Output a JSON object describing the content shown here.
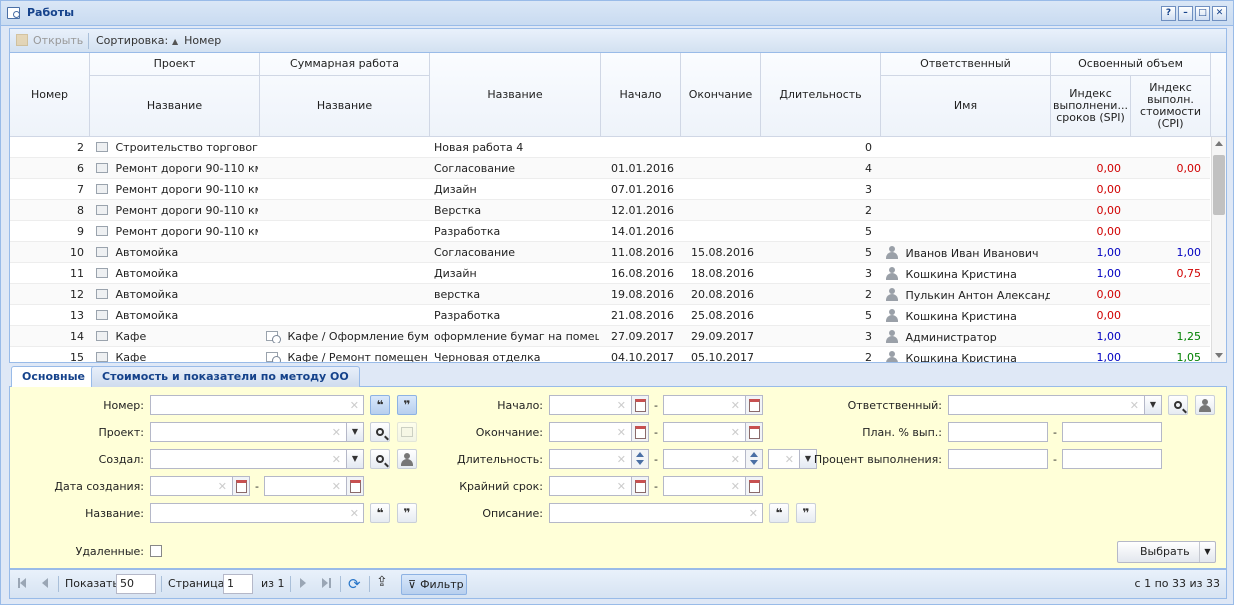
{
  "window": {
    "title": "Работы",
    "tools": [
      "?",
      "–",
      "□",
      "✕"
    ]
  },
  "toolbar": {
    "open_label": "Открыть",
    "sort_label": "Сортировка:",
    "sort_field": "Номер"
  },
  "columns": {
    "number": "Номер",
    "project_group": "Проект",
    "project_name": "Название",
    "summary_group": "Суммарная работа",
    "summary_name": "Название",
    "name": "Название",
    "start": "Начало",
    "end": "Окончание",
    "duration": "Длительность",
    "responsible_group": "Ответственный",
    "responsible_name": "Имя",
    "earned_group": "Освоенный объем",
    "spi": "Индекс выполнени... сроков (SPI)",
    "cpi": "Индекс выполн. стоимости (CPI)"
  },
  "rows": [
    {
      "num": "2",
      "project": "Строительство торговог...",
      "summary": "",
      "name": "Новая работа 4",
      "start": "",
      "end": "",
      "duration": "0",
      "responsible": "",
      "spi": "",
      "spi_color": "",
      "cpi": "",
      "cpi_color": ""
    },
    {
      "num": "6",
      "project": "Ремонт дороги 90-110 км",
      "summary": "",
      "name": "Согласование",
      "start": "01.01.2016",
      "end": "",
      "duration": "4",
      "responsible": "",
      "spi": "0,00",
      "spi_color": "#d00000",
      "cpi": "0,00",
      "cpi_color": "#d00000"
    },
    {
      "num": "7",
      "project": "Ремонт дороги 90-110 км",
      "summary": "",
      "name": "Дизайн",
      "start": "07.01.2016",
      "end": "",
      "duration": "3",
      "responsible": "",
      "spi": "0,00",
      "spi_color": "#d00000",
      "cpi": "",
      "cpi_color": ""
    },
    {
      "num": "8",
      "project": "Ремонт дороги 90-110 км",
      "summary": "",
      "name": "Верстка",
      "start": "12.01.2016",
      "end": "",
      "duration": "2",
      "responsible": "",
      "spi": "0,00",
      "spi_color": "#d00000",
      "cpi": "",
      "cpi_color": ""
    },
    {
      "num": "9",
      "project": "Ремонт дороги 90-110 км",
      "summary": "",
      "name": "Разработка",
      "start": "14.01.2016",
      "end": "",
      "duration": "5",
      "responsible": "",
      "spi": "0,00",
      "spi_color": "#d00000",
      "cpi": "",
      "cpi_color": ""
    },
    {
      "num": "10",
      "project": "Автомойка",
      "summary": "",
      "name": "Согласование",
      "start": "11.08.2016",
      "end": "15.08.2016",
      "duration": "5",
      "responsible": "Иванов Иван Иванович",
      "spi": "1,00",
      "spi_color": "#0000c0",
      "cpi": "1,00",
      "cpi_color": "#0000c0"
    },
    {
      "num": "11",
      "project": "Автомойка",
      "summary": "",
      "name": "Дизайн",
      "start": "16.08.2016",
      "end": "18.08.2016",
      "duration": "3",
      "responsible": "Кошкина Кристина",
      "spi": "1,00",
      "spi_color": "#0000c0",
      "cpi": "0,75",
      "cpi_color": "#d00000"
    },
    {
      "num": "12",
      "project": "Автомойка",
      "summary": "",
      "name": "верстка",
      "start": "19.08.2016",
      "end": "20.08.2016",
      "duration": "2",
      "responsible": "Пулькин Антон Александ...",
      "spi": "0,00",
      "spi_color": "#d00000",
      "cpi": "",
      "cpi_color": ""
    },
    {
      "num": "13",
      "project": "Автомойка",
      "summary": "",
      "name": "Разработка",
      "start": "21.08.2016",
      "end": "25.08.2016",
      "duration": "5",
      "responsible": "Кошкина Кристина",
      "spi": "0,00",
      "spi_color": "#d00000",
      "cpi": "",
      "cpi_color": ""
    },
    {
      "num": "14",
      "project": "Кафе",
      "summary": "Кафе / Оформление бум...",
      "name": "оформление бумаг на помещ...",
      "start": "27.09.2017",
      "end": "29.09.2017",
      "duration": "3",
      "responsible": "Администратор",
      "spi": "1,00",
      "spi_color": "#0000c0",
      "cpi": "1,25",
      "cpi_color": "#008000"
    },
    {
      "num": "15",
      "project": "Кафе",
      "summary": "Кафе / Ремонт помещения",
      "name": "Черновая отделка",
      "start": "04.10.2017",
      "end": "05.10.2017",
      "duration": "2",
      "responsible": "Кошкина Кристина",
      "spi": "1,00",
      "spi_color": "#0000c0",
      "cpi": "1,05",
      "cpi_color": "#008000"
    }
  ],
  "tabs": [
    "Основные",
    "Стоимость и показатели по методу ОО"
  ],
  "filter": {
    "number": "Номер:",
    "project": "Проект:",
    "created_by": "Создал:",
    "created_date": "Дата создания:",
    "name": "Название:",
    "start": "Начало:",
    "end": "Окончание:",
    "duration": "Длительность:",
    "deadline": "Крайний срок:",
    "description": "Описание:",
    "responsible": "Ответственный:",
    "plan_pct": "План. % вып.:",
    "done_pct": "Процент выполнения:",
    "deleted": "Удаленные:",
    "select_button": "Выбрать",
    "dash": "-",
    "quote_open": "❝",
    "quote_close": "❞"
  },
  "pager": {
    "show_label": "Показать",
    "page_size": "50",
    "page_label": "Страница",
    "page": "1",
    "of_label": "из 1",
    "filter_label": "Фильтр",
    "summary": "с 1 по 33 из 33"
  }
}
